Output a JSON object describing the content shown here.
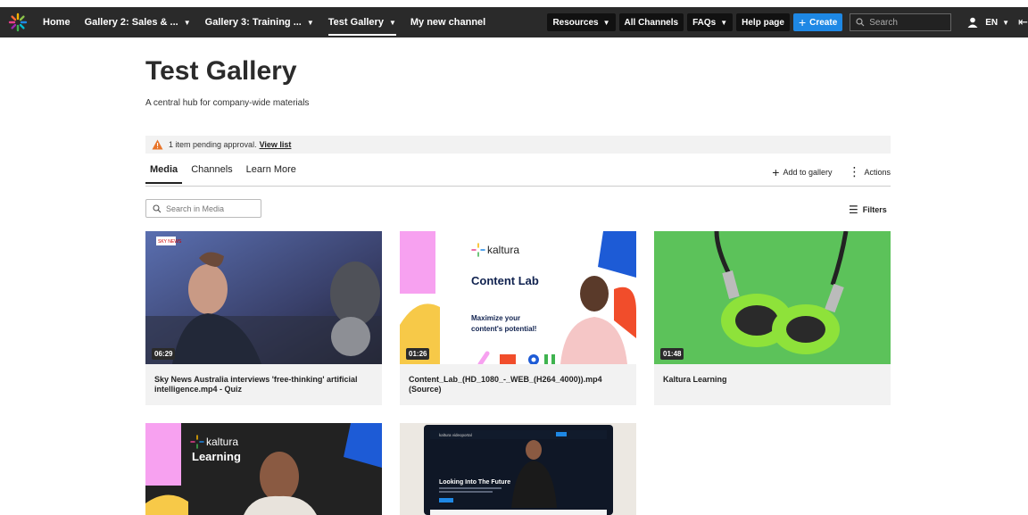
{
  "nav": {
    "items": [
      {
        "label": "Home",
        "has_menu": false
      },
      {
        "label": "Gallery 2: Sales & ...",
        "has_menu": true
      },
      {
        "label": "Gallery 3: Training ...",
        "has_menu": true
      },
      {
        "label": "Test Gallery",
        "has_menu": true,
        "active": true
      },
      {
        "label": "My new channel",
        "has_menu": false
      }
    ],
    "right": {
      "resources": "Resources",
      "all_channels": "All Channels",
      "faqs": "FAQs",
      "help_page": "Help page",
      "create": "Create",
      "search_placeholder": "Search",
      "language": "EN"
    }
  },
  "page": {
    "title": "Test Gallery",
    "subtitle": "A central hub for company-wide materials"
  },
  "pending": {
    "text": "1 item pending approval.",
    "link": "View list"
  },
  "tabs": [
    {
      "label": "Media",
      "active": true
    },
    {
      "label": "Channels",
      "active": false
    },
    {
      "label": "Learn More",
      "active": false
    }
  ],
  "tab_actions": {
    "add": "Add to gallery",
    "actions": "Actions"
  },
  "media_search": {
    "placeholder": "Search in Media"
  },
  "filters_label": "Filters",
  "cards": [
    {
      "duration": "06:29",
      "title": "Sky News Australia interviews 'free-thinking' artificial intelligence.mp4 - Quiz",
      "badge": "SKY NEWS"
    },
    {
      "duration": "01:26",
      "title": "Content_Lab_(HD_1080_-_WEB_(H264_4000)).mp4 (Source)",
      "brand": "kaltura",
      "headline": "Content Lab",
      "tagline": "Maximize your content's potential!"
    },
    {
      "duration": "01:48",
      "title": "Kaltura Learning"
    },
    {
      "brand": "kaltura",
      "headline": "Learning"
    },
    {
      "brand": "kaltura videoportal",
      "headline": "Looking Into The Future"
    }
  ],
  "colors": {
    "nav_bg": "#2a2a2a",
    "create_blue": "#1e88e5",
    "warning": "#e8752a",
    "card_bg": "#f2f2f2"
  }
}
